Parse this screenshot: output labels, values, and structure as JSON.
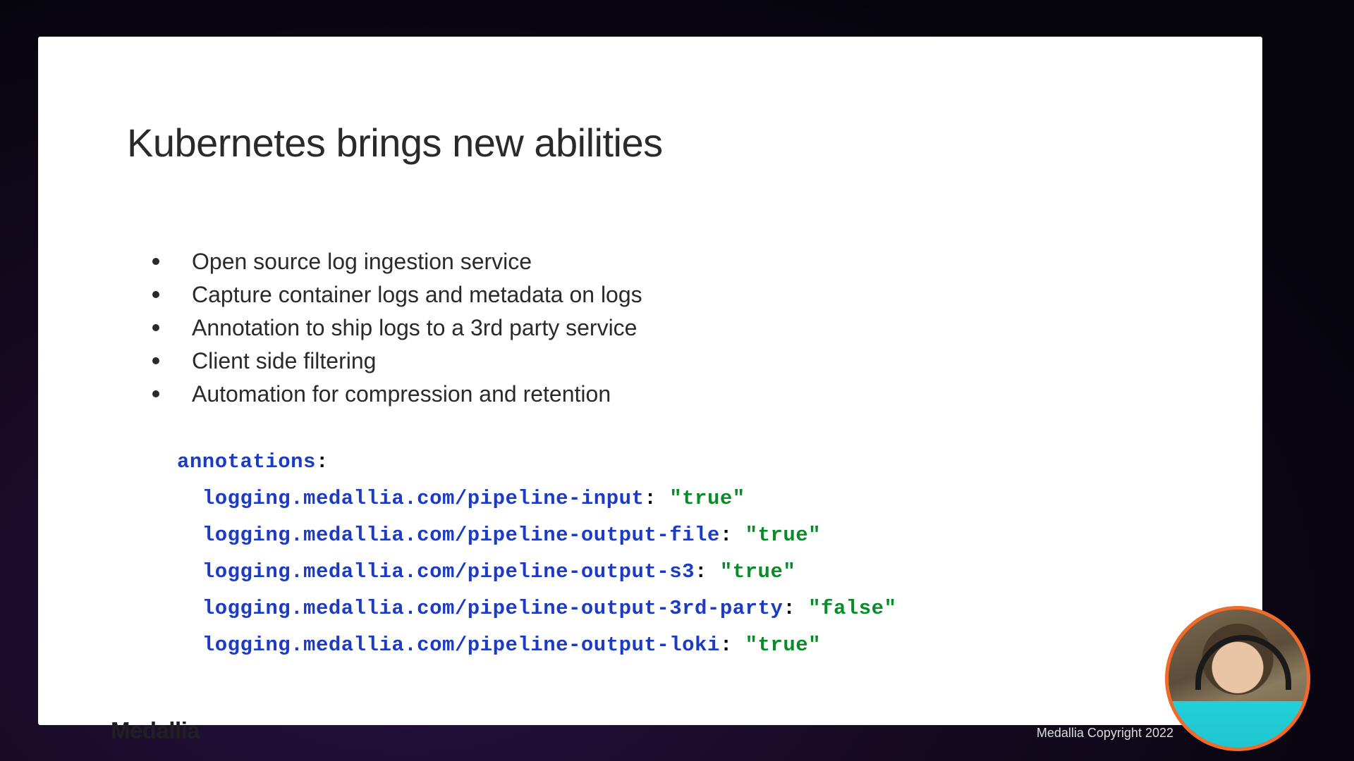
{
  "title": "Kubernetes brings new abilities",
  "bullets": [
    "Open source log ingestion service",
    "Capture container logs and metadata on logs",
    "Annotation to ship logs to a 3rd party service",
    "Client side filtering",
    "Automation for compression and retention"
  ],
  "code": {
    "header_key": "annotations",
    "lines": [
      {
        "key": "logging.medallia.com/pipeline-input",
        "value": "\"true\""
      },
      {
        "key": "logging.medallia.com/pipeline-output-file",
        "value": "\"true\""
      },
      {
        "key": "logging.medallia.com/pipeline-output-s3",
        "value": "\"true\""
      },
      {
        "key": "logging.medallia.com/pipeline-output-3rd-party",
        "value": "\"false\""
      },
      {
        "key": "logging.medallia.com/pipeline-output-loki",
        "value": "\"true\""
      }
    ]
  },
  "brand": "Medallia",
  "copyright": "Medallia    Copyright 2022"
}
